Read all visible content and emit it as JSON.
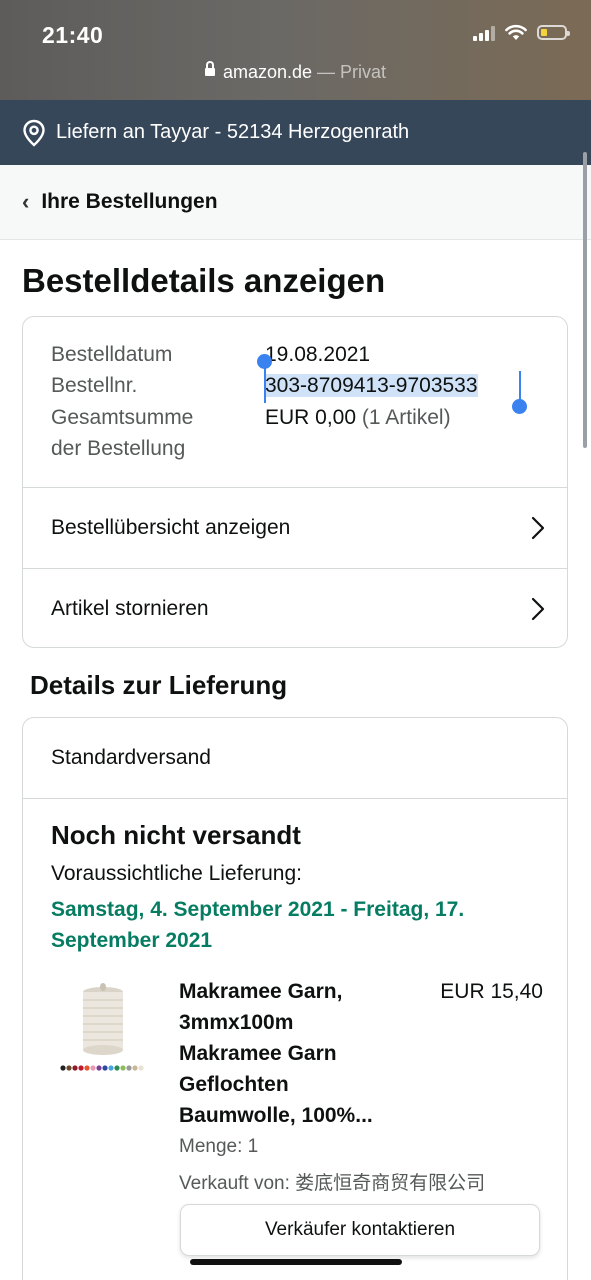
{
  "status_bar": {
    "time": "21:40"
  },
  "browser": {
    "domain": "amazon.de",
    "mode": " — Privat"
  },
  "delivery_bar": {
    "text": "Liefern an Tayyar - 52134 Herzogenrath"
  },
  "breadcrumb": {
    "label": "Ihre Bestellungen"
  },
  "page_title": "Bestelldetails anzeigen",
  "order": {
    "date_label": "Bestelldatum",
    "date_value": "19.08.2021",
    "number_label": "Bestellnr.",
    "number_value": "303-8709413-9703533",
    "total_label_1": "Gesamtsumme",
    "total_label_2": "der Bestellung",
    "total_value": "EUR 0,00",
    "total_items": "(1 Artikel)",
    "overview_link": "Bestellübersicht anzeigen",
    "cancel_link": "Artikel stornieren"
  },
  "delivery_section": {
    "title": "Details zur Lieferung",
    "shipping_method": "Standardversand",
    "status": "Noch nicht versandt",
    "eta_label": "Voraussichtliche Lieferung:",
    "eta_dates": "Samstag, 4. September 2021 - Freitag, 17. September 2021",
    "product": {
      "title_1": "Makramee Garn,",
      "title_2": "3mmx100m",
      "title_3": "Makramee Garn",
      "title_4": "Geflochten",
      "title_5": "Baumwolle, 100%...",
      "price": "EUR 15,40",
      "quantity": "Menge: 1",
      "seller": "Verkauft von: 娄底恒奇商贸有限公司",
      "image": "macrame-cotton-spool"
    },
    "contact_button": "Verkäufer kontaktieren"
  },
  "colors": {
    "delivery_bar": "#37475a",
    "eta_green": "#067d62",
    "selection": "#cfe2f8",
    "selection_handle": "#3a82f0"
  }
}
